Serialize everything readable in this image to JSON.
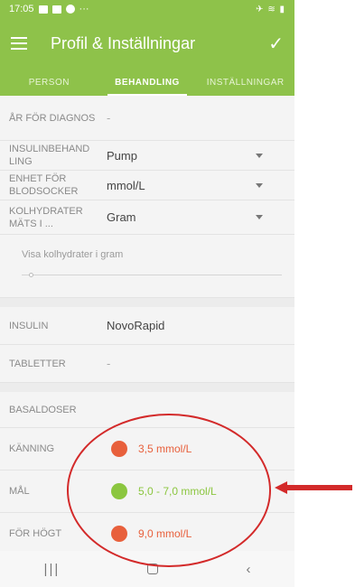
{
  "status": {
    "time": "17:05",
    "dots": "···",
    "right": "✈ ≋ ▮"
  },
  "header": {
    "title": "Profil & Inställningar",
    "check": "✓"
  },
  "tabs": [
    {
      "label": "PERSON"
    },
    {
      "label": "BEHANDLING"
    },
    {
      "label": "INSTÄLLNINGAR"
    }
  ],
  "rows": {
    "diagnos": {
      "label": "ÅR FÖR DIAGNOS",
      "value": "-"
    },
    "insulinbehandling": {
      "label": "INSULINBEHAND LING",
      "value": "Pump"
    },
    "enhet": {
      "label": "ENHET FÖR BLODSOCKER",
      "value": "mmol/L"
    },
    "kolhydrater": {
      "label": "KOLHYDRATER MÄTS I ...",
      "value": "Gram"
    },
    "visa_kolhydrater": "Visa kolhydrater i gram",
    "insulin": {
      "label": "INSULIN",
      "value": "NovoRapid"
    },
    "tabletter": {
      "label": "TABLETTER",
      "value": "-"
    },
    "basaldoser": {
      "label": "BASALDOSER"
    }
  },
  "levels": [
    {
      "label": "KÄNNING",
      "value": "3,5 mmol/L",
      "color": "#e8603c",
      "text_color": "#e8603c"
    },
    {
      "label": "MÅL",
      "value": "5,0 - 7,0 mmol/L",
      "color": "#8bc63f",
      "text_color": "#8bc63f"
    },
    {
      "label": "FÖR HÖGT",
      "value": "9,0 mmol/L",
      "color": "#e8603c",
      "text_color": "#e8603c"
    }
  ],
  "nav": {
    "recent": "|||",
    "back": "‹"
  },
  "colors": {
    "brand": "#8ec24a",
    "annotation": "#d32a2a"
  }
}
